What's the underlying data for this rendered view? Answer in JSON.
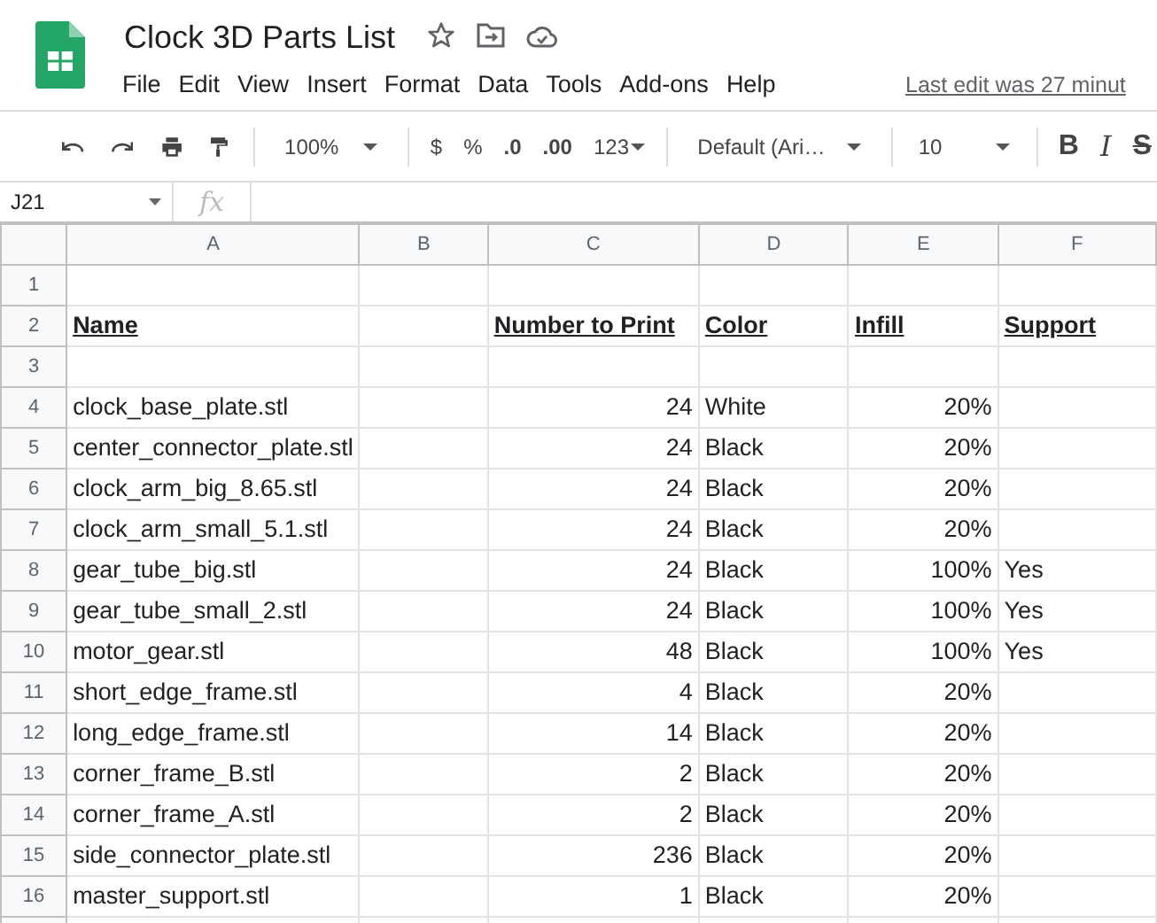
{
  "document": {
    "title": "Clock 3D Parts List",
    "starred": false
  },
  "menu": [
    "File",
    "Edit",
    "View",
    "Insert",
    "Format",
    "Data",
    "Tools",
    "Add-ons",
    "Help"
  ],
  "last_edit": "Last edit was 27 minut",
  "toolbar": {
    "zoom": "100%",
    "currency": "$",
    "percent": "%",
    "decrease_decimals": ".0",
    "increase_decimals": ".00",
    "more_formats": "123",
    "font": "Default (Ari…",
    "font_size": "10",
    "bold": "B",
    "italic": "I",
    "strikethrough": "S"
  },
  "formula_bar": {
    "cell_reference": "J21",
    "fx": "fx"
  },
  "columns": [
    "A",
    "B",
    "C",
    "D",
    "E",
    "F"
  ],
  "rows": [
    {
      "number": "1",
      "cells": {}
    },
    {
      "number": "2",
      "kind": "header",
      "cells": {
        "A": "Name",
        "C": "Number to Print",
        "D": "Color",
        "E": "Infill",
        "F": "Support"
      }
    },
    {
      "number": "3",
      "cells": {}
    },
    {
      "number": "4",
      "kind": "data",
      "cells": {
        "A": "clock_base_plate.stl",
        "C": "24",
        "D": "White",
        "E": "20%"
      }
    },
    {
      "number": "5",
      "kind": "data",
      "cells": {
        "A": "center_connector_plate.stl",
        "C": "24",
        "D": "Black",
        "E": "20%"
      }
    },
    {
      "number": "6",
      "kind": "data",
      "cells": {
        "A": "clock_arm_big_8.65.stl",
        "C": "24",
        "D": "Black",
        "E": "20%"
      }
    },
    {
      "number": "7",
      "kind": "data",
      "cells": {
        "A": "clock_arm_small_5.1.stl",
        "C": "24",
        "D": "Black",
        "E": "20%"
      }
    },
    {
      "number": "8",
      "kind": "data",
      "cells": {
        "A": "gear_tube_big.stl",
        "C": "24",
        "D": "Black",
        "E": "100%",
        "F": "Yes"
      }
    },
    {
      "number": "9",
      "kind": "data",
      "cells": {
        "A": "gear_tube_small_2.stl",
        "C": "24",
        "D": "Black",
        "E": "100%",
        "F": "Yes"
      }
    },
    {
      "number": "10",
      "kind": "data",
      "cells": {
        "A": "motor_gear.stl",
        "C": "48",
        "D": "Black",
        "E": "100%",
        "F": "Yes"
      }
    },
    {
      "number": "11",
      "kind": "data",
      "cells": {
        "A": "short_edge_frame.stl",
        "C": "4",
        "D": "Black",
        "E": "20%"
      }
    },
    {
      "number": "12",
      "kind": "data",
      "cells": {
        "A": "long_edge_frame.stl",
        "C": "14",
        "D": "Black",
        "E": "20%"
      }
    },
    {
      "number": "13",
      "kind": "data",
      "cells": {
        "A": "corner_frame_B.stl",
        "C": "2",
        "D": "Black",
        "E": "20%"
      }
    },
    {
      "number": "14",
      "kind": "data",
      "cells": {
        "A": "corner_frame_A.stl",
        "C": "2",
        "D": "Black",
        "E": "20%"
      }
    },
    {
      "number": "15",
      "kind": "data",
      "cells": {
        "A": "side_connector_plate.stl",
        "C": "236",
        "D": "Black",
        "E": "20%"
      }
    },
    {
      "number": "16",
      "kind": "data",
      "cells": {
        "A": "master_support.stl",
        "C": "1",
        "D": "Black",
        "E": "20%"
      }
    }
  ]
}
